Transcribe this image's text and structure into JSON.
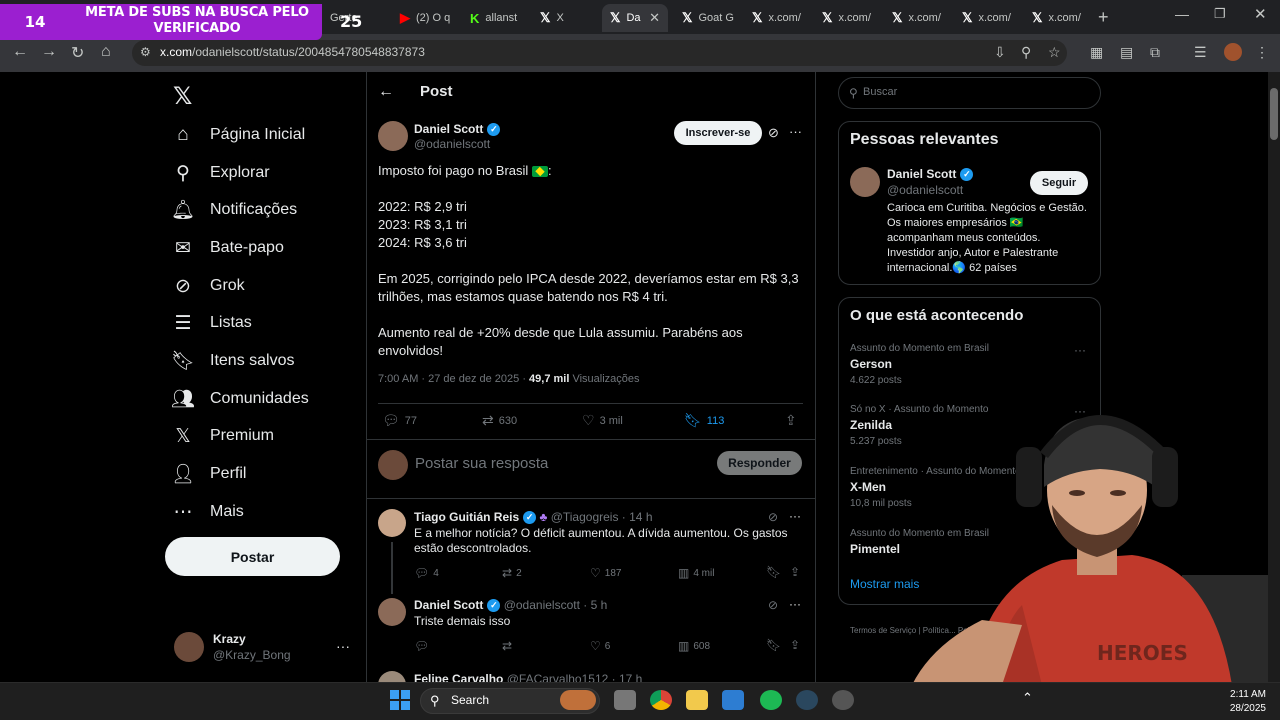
{
  "overlay": {
    "counter": "14",
    "banner": "META DE SUBS NA BUSCA PELO VERIFICADO",
    "badge": "25"
  },
  "browser": {
    "tabs": [
      {
        "label": "Gerte",
        "active": false
      },
      {
        "label": "(2) O q",
        "active": false
      },
      {
        "label": "allanst",
        "active": false
      },
      {
        "label": "X",
        "active": false
      },
      {
        "label": "Da",
        "active": true
      },
      {
        "label": "Goat G",
        "active": false
      },
      {
        "label": "x.com/",
        "active": false
      },
      {
        "label": "x.com/",
        "active": false
      },
      {
        "label": "x.com/",
        "active": false
      },
      {
        "label": "x.com/",
        "active": false
      },
      {
        "label": "x.com/",
        "active": false
      }
    ],
    "url_domain": "x.com",
    "url_path": "/odanielscott/status/2004854780548837873"
  },
  "sidebar": {
    "items": [
      {
        "label": "Página Inicial",
        "icon": "⌂",
        "name": "home"
      },
      {
        "label": "Explorar",
        "icon": "⚲",
        "name": "explore"
      },
      {
        "label": "Notificações",
        "icon": "🔔︎",
        "name": "notifications"
      },
      {
        "label": "Bate-papo",
        "icon": "✉",
        "name": "chat"
      },
      {
        "label": "Grok",
        "icon": "⊘",
        "name": "grok"
      },
      {
        "label": "Listas",
        "icon": "☰",
        "name": "lists"
      },
      {
        "label": "Itens salvos",
        "icon": "🔖︎",
        "name": "bookmarks"
      },
      {
        "label": "Comunidades",
        "icon": "👥︎",
        "name": "communities"
      },
      {
        "label": "Premium",
        "icon": "𝕏",
        "name": "premium"
      },
      {
        "label": "Perfil",
        "icon": "👤︎",
        "name": "profile"
      },
      {
        "label": "Mais",
        "icon": "⋯",
        "name": "more"
      }
    ],
    "post_button": "Postar",
    "account": {
      "name": "Krazy",
      "handle": "@Krazy_Bong"
    }
  },
  "post": {
    "header": "Post",
    "author": {
      "name": "Daniel Scott",
      "handle": "@odanielscott"
    },
    "subscribe": "Inscrever-se",
    "line1": "Imposto foi pago no Brasil",
    "line1_suffix": ":",
    "line2": "2022: R$ 2,9 tri",
    "line3": "2023: R$ 3,1 tri",
    "line4": "2024: R$ 3,6 tri",
    "para2": "Em 2025, corrigindo pelo IPCA desde 2022, deveríamos estar em R$ 3,3 trilhões, mas estamos quase batendo nos R$ 4 tri.",
    "para3": "Aumento real de +20% desde que Lula assumiu. Parabéns aos envolvidos!",
    "timestamp": "7:00 AM · 27 de dez de 2025 · ",
    "views": "49,7 mil",
    "views_label": " Visualizações",
    "stats": {
      "replies": "77",
      "reposts": "630",
      "likes": "3 mil",
      "bookmarks": "113"
    },
    "reply_placeholder": "Postar sua resposta",
    "reply_button": "Responder"
  },
  "comments": [
    {
      "name": "Tiago Guitián Reis",
      "handle": "@Tiagogreis · 14 h",
      "text": "E a melhor notícia? O déficit aumentou. A dívida aumentou. Os gastos estão descontrolados.",
      "replies": "4",
      "reposts": "2",
      "likes": "187",
      "views": "4 mil"
    },
    {
      "name": "Daniel Scott",
      "handle": "@odanielscott · 5 h",
      "text": "Triste demais isso",
      "replies": "",
      "reposts": "",
      "likes": "6",
      "views": "608"
    },
    {
      "name": "Felipe Carvalho",
      "handle": "@FACarvalho1512 · 17 h"
    }
  ],
  "right": {
    "search_placeholder": "Buscar",
    "relevant_title": "Pessoas relevantes",
    "relevant": {
      "name": "Daniel Scott",
      "handle": "@odanielscott",
      "follow": "Seguir",
      "bio": "Carioca em Curitiba. Negócios e Gestão. Os maiores empresários 🇧🇷 acompanham meus conteúdos. Investidor anjo, Autor e Palestrante internacional.🌎 62 países"
    },
    "trending_title": "O que está acontecendo",
    "trends": [
      {
        "context": "Assunto do Momento em Brasil",
        "name": "Gerson",
        "count": "4.622 posts"
      },
      {
        "context": "Só no X · Assunto do Momento",
        "name": "Zenilda",
        "count": "5.237 posts"
      },
      {
        "context": "Entretenimento · Assunto do Momento",
        "name": "X-Men",
        "count": "10,8 mil posts"
      },
      {
        "context": "Assunto do Momento em Brasil",
        "name": "Pimentel",
        "count": ""
      }
    ],
    "show_more": "Mostrar mais",
    "footer": "Termos de Serviço  |  Política...  Política de cookies  Informações..."
  },
  "taskbar": {
    "search": "Search",
    "time": "2:11 AM",
    "date": "28/2025"
  },
  "colors": {
    "accent": "#1d9bf0",
    "overlay": "#9b1fd0",
    "background": "#000000"
  }
}
